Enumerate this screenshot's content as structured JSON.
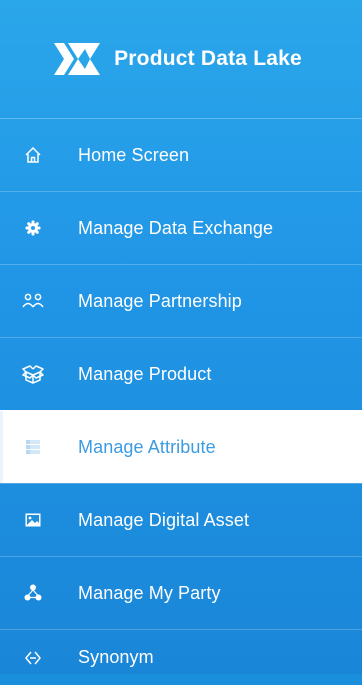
{
  "brand": {
    "name": "Product Data Lake",
    "logo_icon": "pdl-x-logo-icon"
  },
  "colors": {
    "sidebar_top": "#2aa6ea",
    "sidebar_bottom": "#1a86d8",
    "active_bg": "#ffffff",
    "active_text": "#3d9be0"
  },
  "menu": [
    {
      "label": "Home Screen",
      "icon": "home-icon",
      "active": false
    },
    {
      "label": "Manage Data Exchange",
      "icon": "gear-icon",
      "active": false
    },
    {
      "label": "Manage Partnership",
      "icon": "users-icon",
      "active": false
    },
    {
      "label": "Manage Product",
      "icon": "box-icon",
      "active": false
    },
    {
      "label": "Manage Attribute",
      "icon": "list-icon",
      "active": true
    },
    {
      "label": "Manage Digital Asset",
      "icon": "image-icon",
      "active": false
    },
    {
      "label": "Manage My Party",
      "icon": "party-icon",
      "active": false
    },
    {
      "label": "Synonym",
      "icon": "synonym-icon",
      "active": false
    }
  ]
}
